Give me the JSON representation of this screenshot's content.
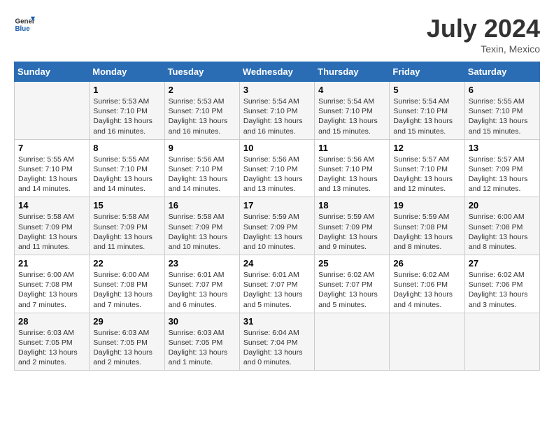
{
  "logo": {
    "line1": "General",
    "line2": "Blue"
  },
  "title": "July 2024",
  "location": "Texin, Mexico",
  "days_header": [
    "Sunday",
    "Monday",
    "Tuesday",
    "Wednesday",
    "Thursday",
    "Friday",
    "Saturday"
  ],
  "weeks": [
    [
      {
        "num": "",
        "info": ""
      },
      {
        "num": "1",
        "info": "Sunrise: 5:53 AM\nSunset: 7:10 PM\nDaylight: 13 hours\nand 16 minutes."
      },
      {
        "num": "2",
        "info": "Sunrise: 5:53 AM\nSunset: 7:10 PM\nDaylight: 13 hours\nand 16 minutes."
      },
      {
        "num": "3",
        "info": "Sunrise: 5:54 AM\nSunset: 7:10 PM\nDaylight: 13 hours\nand 16 minutes."
      },
      {
        "num": "4",
        "info": "Sunrise: 5:54 AM\nSunset: 7:10 PM\nDaylight: 13 hours\nand 15 minutes."
      },
      {
        "num": "5",
        "info": "Sunrise: 5:54 AM\nSunset: 7:10 PM\nDaylight: 13 hours\nand 15 minutes."
      },
      {
        "num": "6",
        "info": "Sunrise: 5:55 AM\nSunset: 7:10 PM\nDaylight: 13 hours\nand 15 minutes."
      }
    ],
    [
      {
        "num": "7",
        "info": "Sunrise: 5:55 AM\nSunset: 7:10 PM\nDaylight: 13 hours\nand 14 minutes."
      },
      {
        "num": "8",
        "info": "Sunrise: 5:55 AM\nSunset: 7:10 PM\nDaylight: 13 hours\nand 14 minutes."
      },
      {
        "num": "9",
        "info": "Sunrise: 5:56 AM\nSunset: 7:10 PM\nDaylight: 13 hours\nand 14 minutes."
      },
      {
        "num": "10",
        "info": "Sunrise: 5:56 AM\nSunset: 7:10 PM\nDaylight: 13 hours\nand 13 minutes."
      },
      {
        "num": "11",
        "info": "Sunrise: 5:56 AM\nSunset: 7:10 PM\nDaylight: 13 hours\nand 13 minutes."
      },
      {
        "num": "12",
        "info": "Sunrise: 5:57 AM\nSunset: 7:10 PM\nDaylight: 13 hours\nand 12 minutes."
      },
      {
        "num": "13",
        "info": "Sunrise: 5:57 AM\nSunset: 7:09 PM\nDaylight: 13 hours\nand 12 minutes."
      }
    ],
    [
      {
        "num": "14",
        "info": "Sunrise: 5:58 AM\nSunset: 7:09 PM\nDaylight: 13 hours\nand 11 minutes."
      },
      {
        "num": "15",
        "info": "Sunrise: 5:58 AM\nSunset: 7:09 PM\nDaylight: 13 hours\nand 11 minutes."
      },
      {
        "num": "16",
        "info": "Sunrise: 5:58 AM\nSunset: 7:09 PM\nDaylight: 13 hours\nand 10 minutes."
      },
      {
        "num": "17",
        "info": "Sunrise: 5:59 AM\nSunset: 7:09 PM\nDaylight: 13 hours\nand 10 minutes."
      },
      {
        "num": "18",
        "info": "Sunrise: 5:59 AM\nSunset: 7:09 PM\nDaylight: 13 hours\nand 9 minutes."
      },
      {
        "num": "19",
        "info": "Sunrise: 5:59 AM\nSunset: 7:08 PM\nDaylight: 13 hours\nand 8 minutes."
      },
      {
        "num": "20",
        "info": "Sunrise: 6:00 AM\nSunset: 7:08 PM\nDaylight: 13 hours\nand 8 minutes."
      }
    ],
    [
      {
        "num": "21",
        "info": "Sunrise: 6:00 AM\nSunset: 7:08 PM\nDaylight: 13 hours\nand 7 minutes."
      },
      {
        "num": "22",
        "info": "Sunrise: 6:00 AM\nSunset: 7:08 PM\nDaylight: 13 hours\nand 7 minutes."
      },
      {
        "num": "23",
        "info": "Sunrise: 6:01 AM\nSunset: 7:07 PM\nDaylight: 13 hours\nand 6 minutes."
      },
      {
        "num": "24",
        "info": "Sunrise: 6:01 AM\nSunset: 7:07 PM\nDaylight: 13 hours\nand 5 minutes."
      },
      {
        "num": "25",
        "info": "Sunrise: 6:02 AM\nSunset: 7:07 PM\nDaylight: 13 hours\nand 5 minutes."
      },
      {
        "num": "26",
        "info": "Sunrise: 6:02 AM\nSunset: 7:06 PM\nDaylight: 13 hours\nand 4 minutes."
      },
      {
        "num": "27",
        "info": "Sunrise: 6:02 AM\nSunset: 7:06 PM\nDaylight: 13 hours\nand 3 minutes."
      }
    ],
    [
      {
        "num": "28",
        "info": "Sunrise: 6:03 AM\nSunset: 7:05 PM\nDaylight: 13 hours\nand 2 minutes."
      },
      {
        "num": "29",
        "info": "Sunrise: 6:03 AM\nSunset: 7:05 PM\nDaylight: 13 hours\nand 2 minutes."
      },
      {
        "num": "30",
        "info": "Sunrise: 6:03 AM\nSunset: 7:05 PM\nDaylight: 13 hours\nand 1 minute."
      },
      {
        "num": "31",
        "info": "Sunrise: 6:04 AM\nSunset: 7:04 PM\nDaylight: 13 hours\nand 0 minutes."
      },
      {
        "num": "",
        "info": ""
      },
      {
        "num": "",
        "info": ""
      },
      {
        "num": "",
        "info": ""
      }
    ]
  ]
}
